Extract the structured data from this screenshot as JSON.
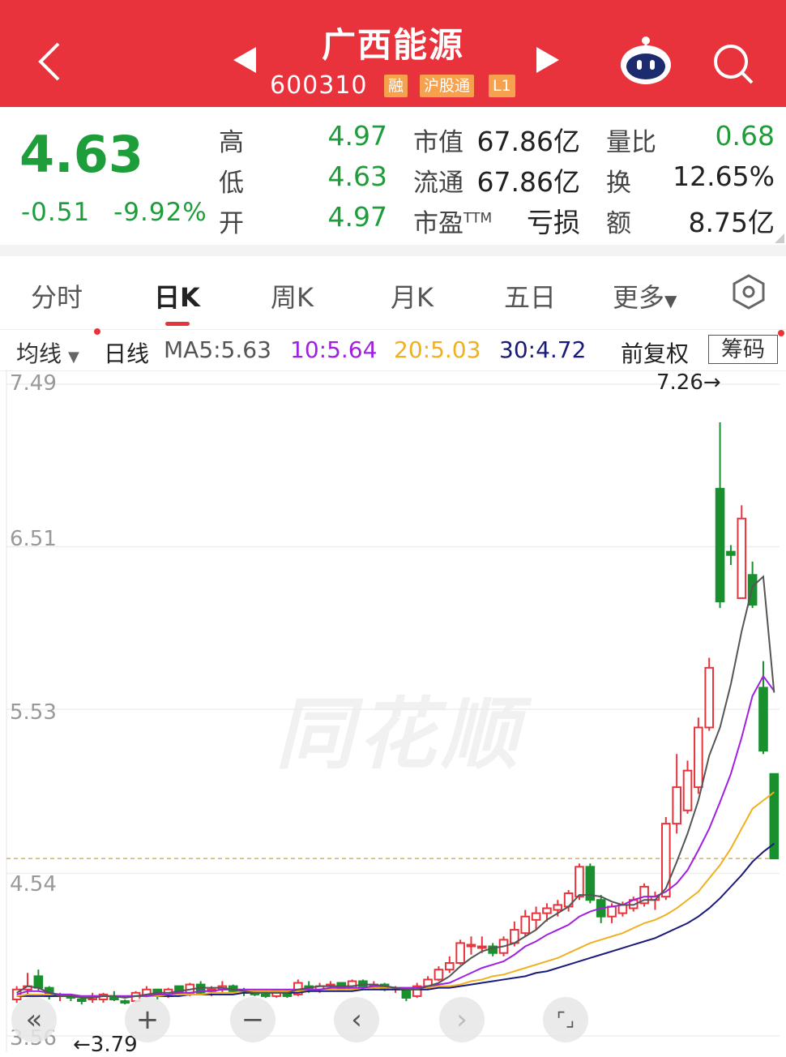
{
  "header": {
    "title": "广西能源",
    "code": "600310",
    "tags": [
      "融",
      "沪股通",
      "L1"
    ],
    "back_icon": "chevron-left-icon",
    "robot_icon": "robot-assistant-icon",
    "search_icon": "search-icon"
  },
  "quote": {
    "price": "4.63",
    "change": "-0.51",
    "change_pct": "-9.92%",
    "high_label": "高",
    "high": "4.97",
    "low_label": "低",
    "low": "4.63",
    "open_label": "开",
    "open": "4.97",
    "mcap_label": "市值",
    "mcap": "67.86亿",
    "float_label": "流通",
    "float": "67.86亿",
    "pe_label": "市盈",
    "pe_sup": "TTM",
    "pe": "亏损",
    "vr_label": "量比",
    "vr": "0.68",
    "turnover_label": "换",
    "turnover": "12.65%",
    "amount_label": "额",
    "amount": "8.75亿"
  },
  "tabs": [
    "分时",
    "日K",
    "周K",
    "月K",
    "五日",
    "更多"
  ],
  "active_tab": "日K",
  "ma_bar": {
    "selector": "均线",
    "period": "日线",
    "ma5": "MA5:5.63",
    "ma10": "10:5.64",
    "ma20": "20:5.03",
    "ma30": "30:4.72",
    "adjust": "前复权",
    "chip": "筹码",
    "colors": {
      "ma5": "#555555",
      "ma10": "#a020e0",
      "ma20": "#f0b020",
      "ma30": "#1a1a7a",
      "up": "#e8333c",
      "down": "#1a8f2e"
    }
  },
  "chart_data": {
    "type": "candlestick",
    "y_ticks": [
      "7.49",
      "6.51",
      "5.53",
      "4.54",
      "3.56"
    ],
    "ylim": [
      3.56,
      7.49
    ],
    "max_label": "7.26→",
    "min_label": "←3.79",
    "watermark": "同花顺",
    "candles": [
      [
        3.78,
        3.86,
        3.76,
        3.84
      ],
      [
        3.84,
        3.94,
        3.8,
        3.86
      ],
      [
        3.92,
        3.96,
        3.83,
        3.85
      ],
      [
        3.85,
        3.86,
        3.78,
        3.8
      ],
      [
        3.8,
        3.82,
        3.77,
        3.81
      ],
      [
        3.8,
        3.81,
        3.77,
        3.79
      ],
      [
        3.78,
        3.8,
        3.75,
        3.77
      ],
      [
        3.78,
        3.82,
        3.76,
        3.8
      ],
      [
        3.78,
        3.82,
        3.76,
        3.81
      ],
      [
        3.8,
        3.83,
        3.77,
        3.78
      ],
      [
        3.77,
        3.78,
        3.75,
        3.76
      ],
      [
        3.77,
        3.83,
        3.76,
        3.82
      ],
      [
        3.8,
        3.86,
        3.79,
        3.84
      ],
      [
        3.84,
        3.84,
        3.78,
        3.8
      ],
      [
        3.8,
        3.85,
        3.79,
        3.84
      ],
      [
        3.86,
        3.86,
        3.8,
        3.82
      ],
      [
        3.82,
        3.88,
        3.8,
        3.87
      ],
      [
        3.87,
        3.89,
        3.81,
        3.82
      ],
      [
        3.83,
        3.86,
        3.8,
        3.84
      ],
      [
        3.84,
        3.89,
        3.82,
        3.86
      ],
      [
        3.86,
        3.87,
        3.82,
        3.83
      ],
      [
        3.83,
        3.85,
        3.8,
        3.82
      ],
      [
        3.82,
        3.84,
        3.8,
        3.81
      ],
      [
        3.81,
        3.83,
        3.79,
        3.8
      ],
      [
        3.8,
        3.84,
        3.79,
        3.83
      ],
      [
        3.83,
        3.84,
        3.79,
        3.8
      ],
      [
        3.81,
        3.9,
        3.8,
        3.88
      ],
      [
        3.86,
        3.89,
        3.82,
        3.84
      ],
      [
        3.84,
        3.88,
        3.82,
        3.86
      ],
      [
        3.86,
        3.89,
        3.84,
        3.87
      ],
      [
        3.88,
        3.88,
        3.83,
        3.84
      ],
      [
        3.84,
        3.9,
        3.83,
        3.89
      ],
      [
        3.89,
        3.9,
        3.84,
        3.86
      ],
      [
        3.86,
        3.89,
        3.84,
        3.87
      ],
      [
        3.87,
        3.88,
        3.83,
        3.84
      ],
      [
        3.84,
        3.86,
        3.82,
        3.85
      ],
      [
        3.84,
        3.85,
        3.77,
        3.79
      ],
      [
        3.8,
        3.88,
        3.79,
        3.86
      ],
      [
        3.86,
        3.92,
        3.84,
        3.9
      ],
      [
        3.9,
        3.98,
        3.89,
        3.96
      ],
      [
        3.96,
        4.04,
        3.94,
        4.0
      ],
      [
        4.0,
        4.14,
        3.99,
        4.12
      ],
      [
        4.1,
        4.16,
        4.05,
        4.11
      ],
      [
        4.1,
        4.16,
        4.06,
        4.1
      ],
      [
        4.1,
        4.12,
        4.04,
        4.06
      ],
      [
        4.06,
        4.16,
        4.04,
        4.14
      ],
      [
        4.12,
        4.25,
        4.1,
        4.2
      ],
      [
        4.18,
        4.32,
        4.16,
        4.28
      ],
      [
        4.26,
        4.34,
        4.2,
        4.3
      ],
      [
        4.3,
        4.36,
        4.25,
        4.33
      ],
      [
        4.32,
        4.38,
        4.28,
        4.35
      ],
      [
        4.34,
        4.44,
        4.31,
        4.42
      ],
      [
        4.4,
        4.6,
        4.38,
        4.58
      ],
      [
        4.58,
        4.6,
        4.36,
        4.38
      ],
      [
        4.38,
        4.41,
        4.24,
        4.28
      ],
      [
        4.28,
        4.36,
        4.24,
        4.34
      ],
      [
        4.3,
        4.37,
        4.28,
        4.35
      ],
      [
        4.33,
        4.4,
        4.31,
        4.38
      ],
      [
        4.36,
        4.48,
        4.34,
        4.46
      ],
      [
        4.38,
        4.43,
        4.32,
        4.4
      ],
      [
        4.4,
        4.88,
        4.38,
        4.84
      ],
      [
        4.84,
        5.26,
        4.78,
        5.06
      ],
      [
        4.92,
        5.22,
        4.9,
        5.16
      ],
      [
        5.06,
        5.48,
        5.02,
        5.42
      ],
      [
        5.42,
        5.84,
        5.4,
        5.78
      ],
      [
        6.86,
        7.26,
        6.14,
        6.18
      ],
      [
        6.48,
        6.52,
        6.4,
        6.46
      ],
      [
        6.2,
        6.76,
        6.2,
        6.68
      ],
      [
        6.34,
        6.42,
        6.14,
        6.16
      ],
      [
        5.66,
        5.82,
        5.26,
        5.28
      ],
      [
        5.14,
        5.14,
        4.63,
        4.63
      ]
    ],
    "ma5": [
      3.82,
      3.86,
      3.85,
      3.82,
      3.8,
      3.8,
      3.79,
      3.79,
      3.8,
      3.8,
      3.79,
      3.8,
      3.81,
      3.82,
      3.82,
      3.83,
      3.84,
      3.85,
      3.85,
      3.85,
      3.84,
      3.83,
      3.82,
      3.82,
      3.82,
      3.82,
      3.84,
      3.85,
      3.86,
      3.86,
      3.86,
      3.86,
      3.87,
      3.87,
      3.86,
      3.85,
      3.84,
      3.84,
      3.86,
      3.88,
      3.92,
      3.98,
      4.03,
      4.07,
      4.09,
      4.1,
      4.12,
      4.16,
      4.2,
      4.26,
      4.3,
      4.34,
      4.41,
      4.41,
      4.4,
      4.37,
      4.35,
      4.35,
      4.38,
      4.38,
      4.45,
      4.61,
      4.78,
      4.98,
      5.25,
      5.42,
      5.68,
      6.0,
      6.27,
      6.33,
      5.63
    ],
    "ma10": [
      3.81,
      3.83,
      3.83,
      3.82,
      3.81,
      3.81,
      3.8,
      3.8,
      3.8,
      3.8,
      3.8,
      3.8,
      3.8,
      3.81,
      3.81,
      3.82,
      3.82,
      3.83,
      3.83,
      3.84,
      3.84,
      3.84,
      3.84,
      3.84,
      3.84,
      3.84,
      3.84,
      3.84,
      3.84,
      3.85,
      3.85,
      3.85,
      3.85,
      3.86,
      3.86,
      3.85,
      3.85,
      3.85,
      3.86,
      3.87,
      3.88,
      3.91,
      3.94,
      3.97,
      3.99,
      4.01,
      4.05,
      4.1,
      4.13,
      4.17,
      4.2,
      4.23,
      4.28,
      4.31,
      4.33,
      4.34,
      4.35,
      4.38,
      4.4,
      4.4,
      4.43,
      4.48,
      4.56,
      4.68,
      4.81,
      4.97,
      5.14,
      5.36,
      5.61,
      5.73,
      5.64
    ],
    "ma20": [
      3.8,
      3.81,
      3.81,
      3.81,
      3.81,
      3.81,
      3.8,
      3.8,
      3.8,
      3.8,
      3.8,
      3.8,
      3.8,
      3.8,
      3.81,
      3.81,
      3.81,
      3.81,
      3.82,
      3.82,
      3.82,
      3.83,
      3.83,
      3.83,
      3.83,
      3.83,
      3.83,
      3.84,
      3.84,
      3.84,
      3.84,
      3.84,
      3.85,
      3.85,
      3.85,
      3.85,
      3.85,
      3.85,
      3.85,
      3.86,
      3.86,
      3.87,
      3.89,
      3.9,
      3.92,
      3.93,
      3.95,
      3.97,
      3.99,
      4.01,
      4.03,
      4.06,
      4.09,
      4.12,
      4.14,
      4.16,
      4.18,
      4.21,
      4.24,
      4.26,
      4.29,
      4.33,
      4.38,
      4.43,
      4.51,
      4.59,
      4.69,
      4.81,
      4.93,
      4.98,
      5.03
    ],
    "ma30": [
      3.8,
      3.8,
      3.8,
      3.8,
      3.8,
      3.8,
      3.8,
      3.8,
      3.8,
      3.8,
      3.8,
      3.8,
      3.8,
      3.8,
      3.8,
      3.8,
      3.81,
      3.81,
      3.81,
      3.81,
      3.81,
      3.82,
      3.82,
      3.82,
      3.82,
      3.82,
      3.82,
      3.83,
      3.83,
      3.83,
      3.83,
      3.83,
      3.84,
      3.84,
      3.84,
      3.84,
      3.84,
      3.84,
      3.84,
      3.85,
      3.85,
      3.86,
      3.87,
      3.88,
      3.89,
      3.9,
      3.91,
      3.92,
      3.94,
      3.95,
      3.97,
      3.99,
      4.01,
      4.03,
      4.05,
      4.07,
      4.09,
      4.11,
      4.13,
      4.15,
      4.18,
      4.21,
      4.24,
      4.28,
      4.33,
      4.39,
      4.46,
      4.53,
      4.61,
      4.67,
      4.72
    ]
  },
  "controls": [
    "«",
    "+",
    "−",
    "‹",
    "›",
    "⌜⌟"
  ]
}
